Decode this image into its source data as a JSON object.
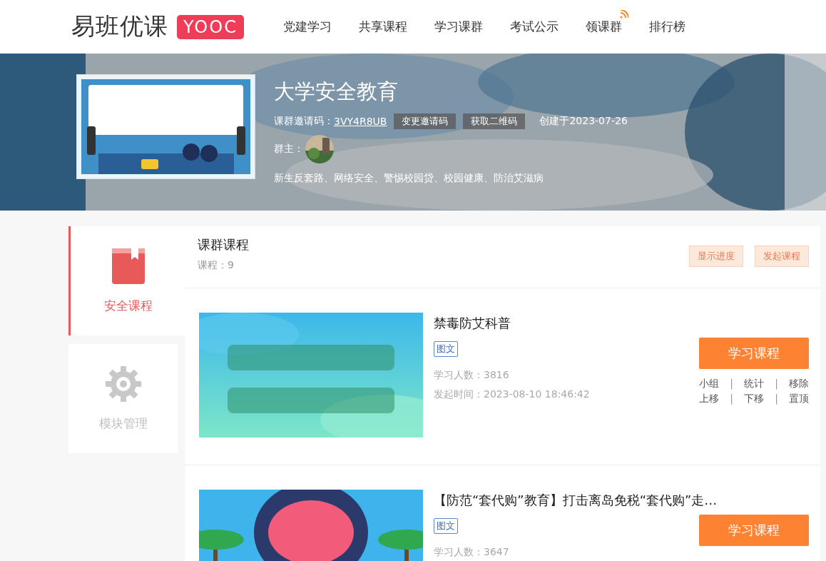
{
  "header": {
    "logo_text": "易班优课",
    "logo_badge": "YOOC",
    "nav": [
      {
        "label": "党建学习",
        "signal": false
      },
      {
        "label": "共享课程",
        "signal": false
      },
      {
        "label": "学习课群",
        "signal": false
      },
      {
        "label": "考试公示",
        "signal": false
      },
      {
        "label": "领课群",
        "signal": true
      },
      {
        "label": "排行榜",
        "signal": false
      }
    ]
  },
  "banner": {
    "title": "大学安全教育",
    "invite_label": "课群邀请码：",
    "invite_code": "3VY4R8UB",
    "buttons": [
      "变更邀请码",
      "获取二维码"
    ],
    "created": "创建于2023-07-26",
    "owner_label": "群主：",
    "topics": "新生反套路、网络安全、警惕校园贷、校园健康、防治艾滋病"
  },
  "sidebar": {
    "items": [
      {
        "label": "安全课程",
        "kind": "book",
        "selected": true
      },
      {
        "label": "模块管理",
        "kind": "gear",
        "selected": false
      }
    ]
  },
  "panel": {
    "title": "课群课程",
    "count": "课程：9",
    "actions": [
      "显示进度",
      "发起课程"
    ],
    "courses": [
      {
        "title": "禁毒防艾科普",
        "tag": "图文",
        "learners": "学习人数：3816",
        "started": "发起时间：2023-08-10 18:46:42",
        "button": "学习课程",
        "separator": "|",
        "links": [
          [
            "小组",
            "统计",
            "移除"
          ],
          [
            "上移",
            "下移",
            "置顶"
          ]
        ]
      },
      {
        "title": "【防范“套代购”教育】打击离岛免税“套代购”走…",
        "tag": "图文",
        "learners": "学习人数：3647",
        "button": "学习课程"
      }
    ]
  }
}
